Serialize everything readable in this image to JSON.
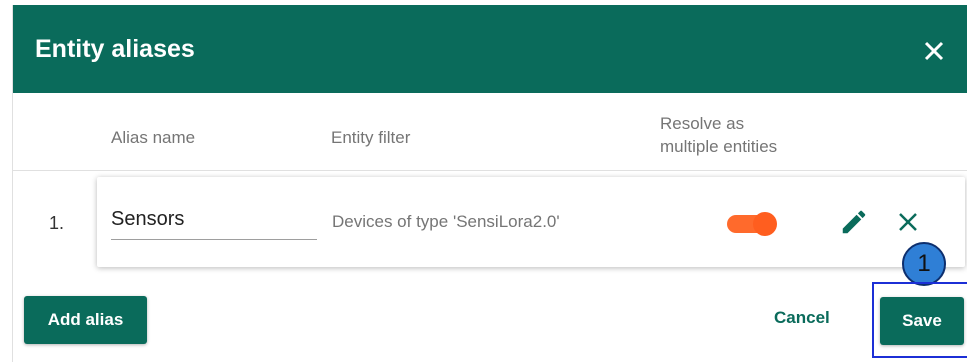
{
  "dialog": {
    "title": "Entity aliases",
    "close_icon": "close-icon"
  },
  "columns": {
    "alias_name": "Alias name",
    "entity_filter": "Entity filter",
    "resolve_multiple_line1": "Resolve as",
    "resolve_multiple_line2": "multiple entities"
  },
  "aliases": [
    {
      "index": "1.",
      "alias_name": "Sensors",
      "entity_filter": "Devices of type 'SensiLora2.0'",
      "resolve_multiple": true,
      "edit_icon": "pencil-icon",
      "remove_icon": "close-icon"
    }
  ],
  "callout": {
    "number": "1"
  },
  "footer": {
    "add_alias": "Add alias",
    "cancel": "Cancel",
    "save": "Save"
  },
  "colors": {
    "brand": "#0a6b5b",
    "toggle_on": "#ff5e1f",
    "callout_fill": "#2f7fd6",
    "highlight_border": "#1c2fd6"
  }
}
